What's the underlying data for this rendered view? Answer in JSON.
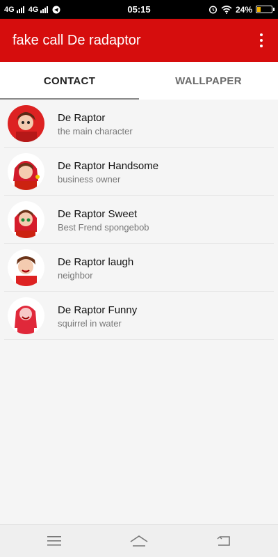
{
  "status_bar": {
    "network1": "4G",
    "network2": "4G",
    "time": "05:15",
    "battery_percent": "24%",
    "battery_level": 0.24
  },
  "app_bar": {
    "title": "fake call De radaptor",
    "menu_icon": "more-vert-icon"
  },
  "tabs": [
    {
      "label": "CONTACT",
      "active": true
    },
    {
      "label": "WALLPAPER",
      "active": false
    }
  ],
  "contacts": [
    {
      "name": "De Raptor",
      "subtitle": "the main character"
    },
    {
      "name": "De Raptor Handsome",
      "subtitle": "business owner"
    },
    {
      "name": "De Raptor Sweet",
      "subtitle": "Best Frend spongebob"
    },
    {
      "name": "De Raptor laugh",
      "subtitle": "neighbor"
    },
    {
      "name": "De Raptor Funny",
      "subtitle": "squirrel in water"
    }
  ],
  "colors": {
    "accent": "#d60d0d"
  },
  "nav_bar": {
    "icons": [
      "menu-icon",
      "home-icon",
      "back-icon"
    ]
  }
}
